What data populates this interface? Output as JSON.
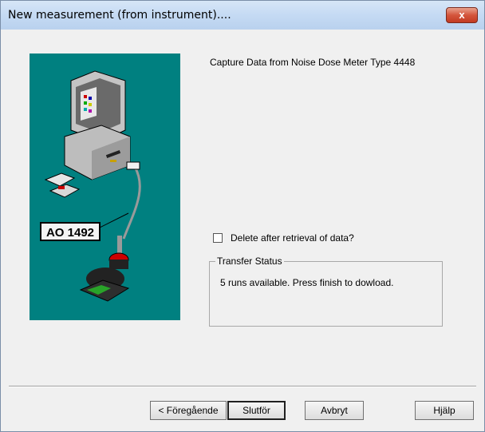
{
  "window": {
    "title": "New measurement (from instrument)....",
    "close_label": "x"
  },
  "illustration": {
    "label": "AO 1492",
    "background": "#008080"
  },
  "heading": "Capture Data from Noise Dose Meter Type 4448",
  "delete_option": {
    "label": "Delete after retrieval of data?",
    "checked": false
  },
  "transfer": {
    "title": "Transfer Status",
    "message": "5 runs available. Press finish to dowload."
  },
  "buttons": {
    "back": "< Föregående",
    "finish": "Slutför",
    "cancel": "Avbryt",
    "help": "Hjälp"
  }
}
